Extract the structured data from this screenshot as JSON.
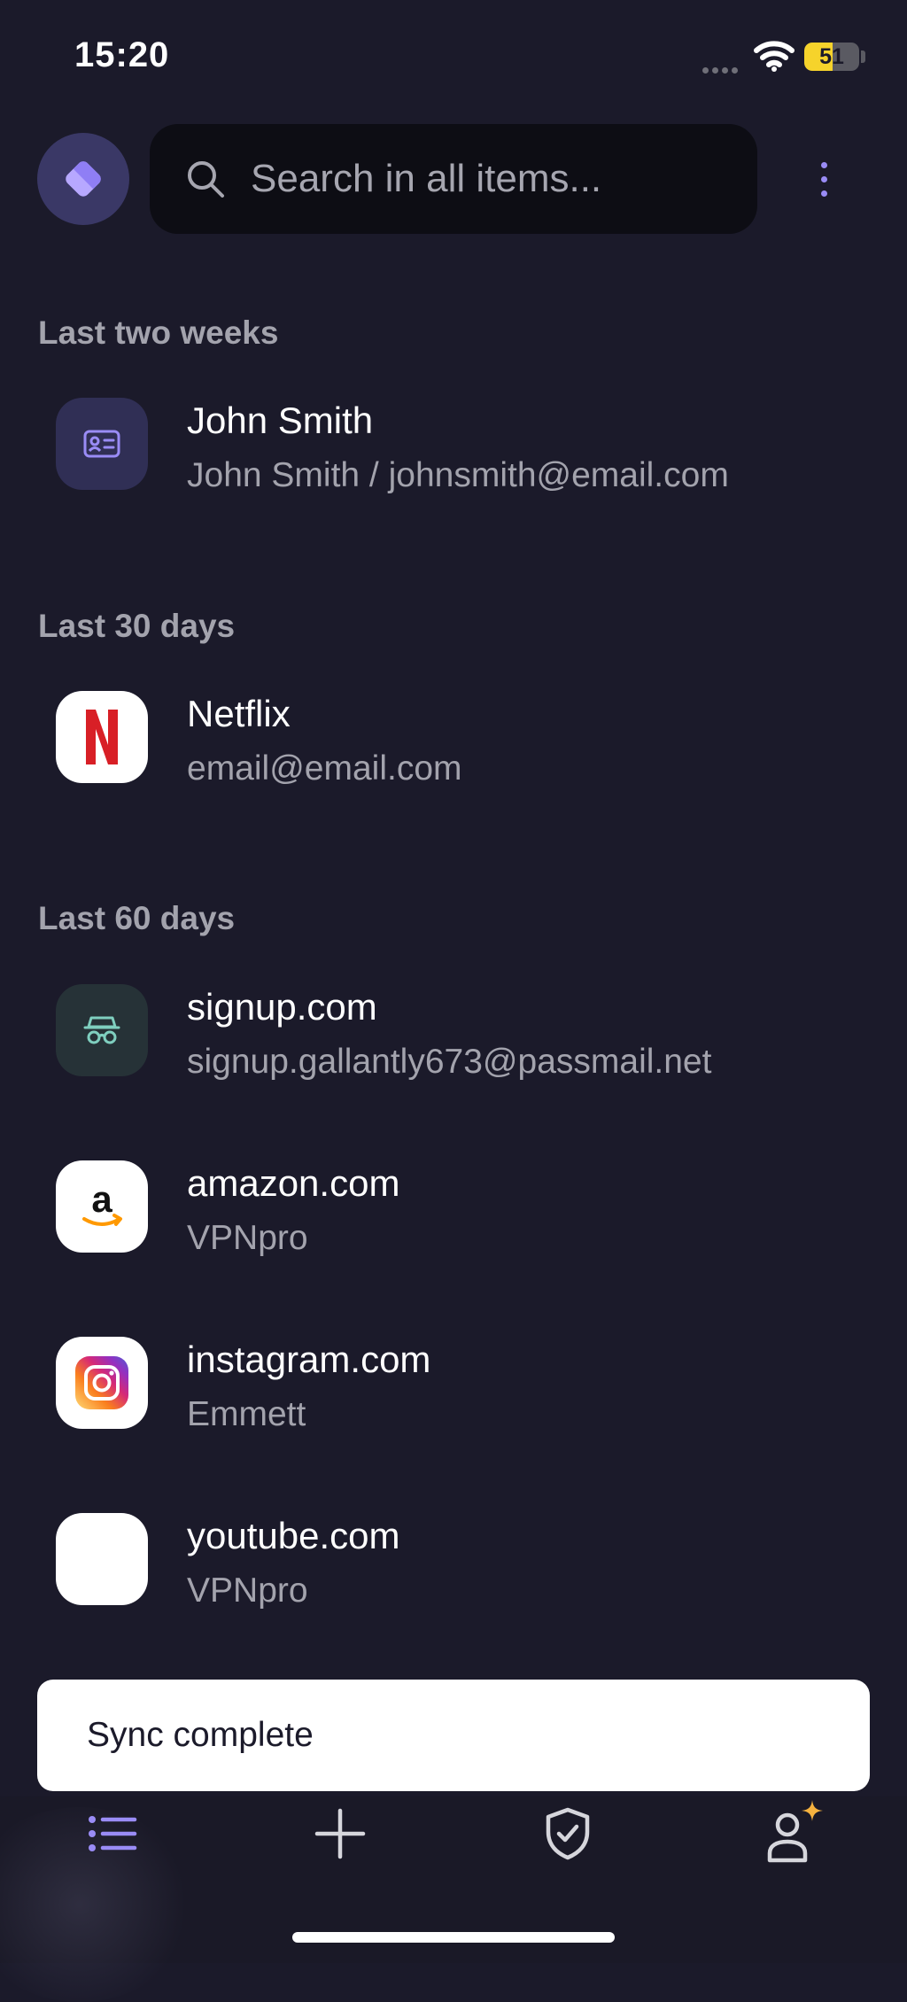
{
  "status_bar": {
    "time": "15:20",
    "battery_level": "51",
    "battery_fraction": 0.51
  },
  "search": {
    "placeholder": "Search in all items..."
  },
  "sections": [
    {
      "title": "Last two weeks",
      "items": [
        {
          "title": "John Smith",
          "subtitle": "John Smith / johnsmith@email.com",
          "icon": "identity-card-icon"
        }
      ]
    },
    {
      "title": "Last 30 days",
      "items": [
        {
          "title": "Netflix",
          "subtitle": "email@email.com",
          "icon": "netflix-logo"
        }
      ]
    },
    {
      "title": "Last 60 days",
      "items": [
        {
          "title": "signup.com",
          "subtitle": "signup.gallantly673@passmail.net",
          "icon": "alias-incognito-icon"
        },
        {
          "title": "amazon.com",
          "subtitle": "VPNpro",
          "icon": "amazon-logo"
        },
        {
          "title": "instagram.com",
          "subtitle": "Emmett",
          "icon": "instagram-logo"
        },
        {
          "title": "youtube.com",
          "subtitle": "VPNpro",
          "icon": "blank-logo"
        }
      ]
    }
  ],
  "toast": {
    "text": "Sync complete"
  },
  "bottom_nav": [
    {
      "name": "items-list",
      "icon": "list-icon",
      "active": true
    },
    {
      "name": "create",
      "icon": "plus-icon",
      "active": false
    },
    {
      "name": "security",
      "icon": "shield-check-icon",
      "active": false
    },
    {
      "name": "profile",
      "icon": "user-sparkle-icon",
      "active": false
    }
  ],
  "colors": {
    "background": "#1b1a2a",
    "accent": "#9a8cf6",
    "muted_text": "#a3a3ad",
    "netflix_red": "#d81f26",
    "amazon_orange": "#ff9900",
    "sparkle": "#f5b23f"
  }
}
